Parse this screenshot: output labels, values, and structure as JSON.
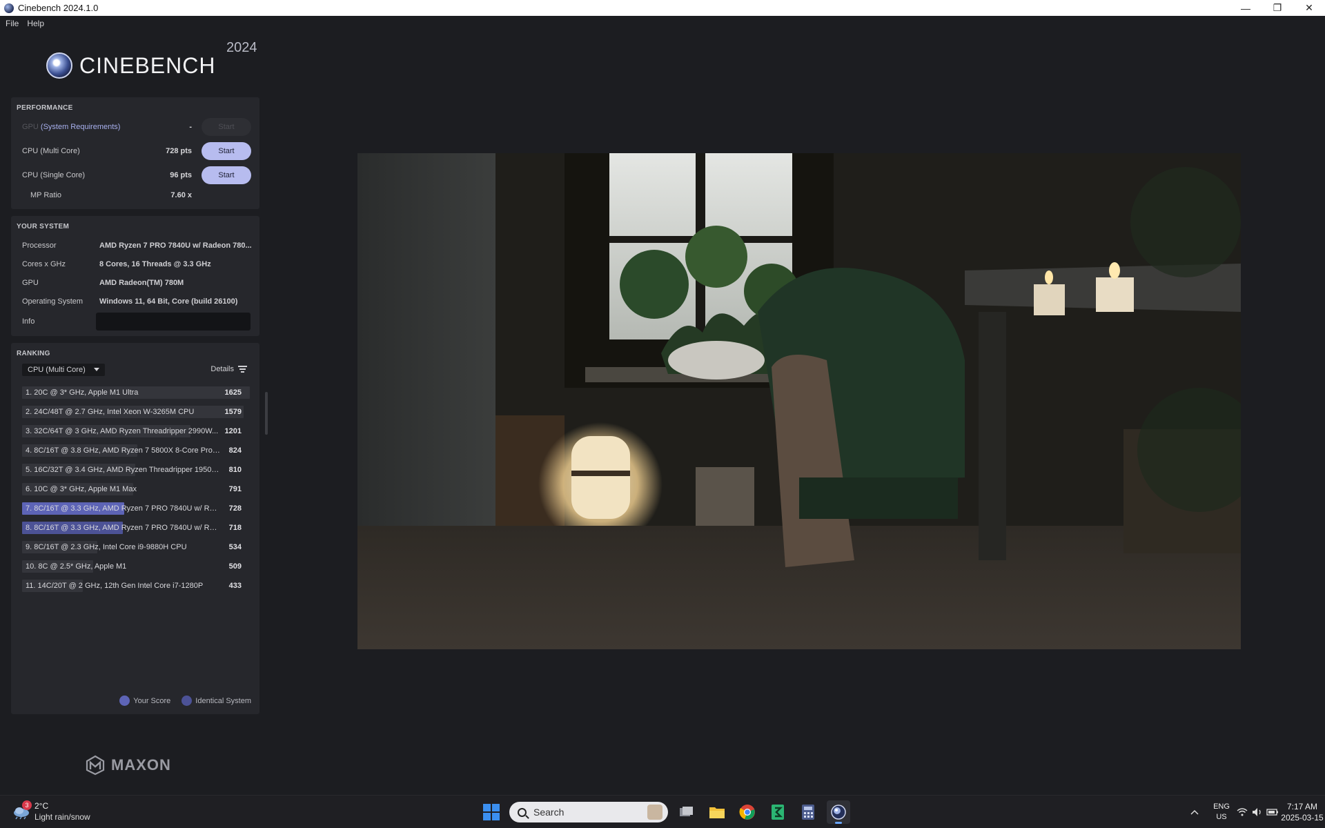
{
  "window": {
    "title": "Cinebench 2024.1.0",
    "controls": {
      "minimize": "—",
      "maximize": "❐",
      "close": "✕"
    }
  },
  "menu": {
    "file": "File",
    "help": "Help"
  },
  "logo": {
    "text": "CINEBENCH",
    "year": "2024"
  },
  "performance": {
    "title": "PERFORMANCE",
    "gpu": {
      "label": "GPU",
      "requirements": "(System Requirements)",
      "value": "-",
      "button": "Start"
    },
    "cpu_multi": {
      "label": "CPU (Multi Core)",
      "value": "728 pts",
      "button": "Start"
    },
    "cpu_single": {
      "label": "CPU (Single Core)",
      "value": "96 pts",
      "button": "Start"
    },
    "mp_ratio": {
      "label": "MP Ratio",
      "value": "7.60 x"
    }
  },
  "system": {
    "title": "YOUR SYSTEM",
    "rows": [
      {
        "key": "Processor",
        "value": "AMD Ryzen 7 PRO 7840U w/ Radeon 780..."
      },
      {
        "key": "Cores x GHz",
        "value": "8 Cores, 16 Threads @ 3.3 GHz"
      },
      {
        "key": "GPU",
        "value": "AMD Radeon(TM) 780M"
      },
      {
        "key": "Operating System",
        "value": "Windows 11, 64 Bit, Core (build 26100)"
      }
    ],
    "info_label": "Info"
  },
  "ranking": {
    "title": "RANKING",
    "dropdown": "CPU (Multi Core)",
    "details": "Details",
    "items": [
      {
        "label": "1. 20C @ 3* GHz, Apple M1 Ultra",
        "score": "1625",
        "fraction": 1.0,
        "kind": "other"
      },
      {
        "label": "2. 24C/48T @ 2.7 GHz, Intel Xeon W-3265M CPU",
        "score": "1579",
        "fraction": 0.972,
        "kind": "other"
      },
      {
        "label": "3. 32C/64T @ 3 GHz, AMD Ryzen Threadripper 2990W...",
        "score": "1201",
        "fraction": 0.739,
        "kind": "other"
      },
      {
        "label": "4. 8C/16T @ 3.8 GHz, AMD Ryzen 7 5800X 8-Core Proce...",
        "score": "824",
        "fraction": 0.507,
        "kind": "other"
      },
      {
        "label": "5. 16C/32T @ 3.4 GHz, AMD Ryzen Threadripper 1950X ...",
        "score": "810",
        "fraction": 0.498,
        "kind": "other"
      },
      {
        "label": "6. 10C @ 3* GHz, Apple M1 Max",
        "score": "791",
        "fraction": 0.487,
        "kind": "other"
      },
      {
        "label": "7. 8C/16T @ 3.3 GHz, AMD Ryzen 7 PRO 7840U w/ Rade...",
        "score": "728",
        "fraction": 0.448,
        "kind": "you"
      },
      {
        "label": "8. 8C/16T @ 3.3 GHz, AMD Ryzen 7 PRO 7840U w/ Rade...",
        "score": "718",
        "fraction": 0.442,
        "kind": "ident"
      },
      {
        "label": "9. 8C/16T @ 2.3 GHz, Intel Core i9-9880H CPU",
        "score": "534",
        "fraction": 0.329,
        "kind": "other"
      },
      {
        "label": "10. 8C @ 2.5* GHz, Apple M1",
        "score": "509",
        "fraction": 0.313,
        "kind": "other"
      },
      {
        "label": "11. 14C/20T @ 2 GHz, 12th Gen Intel Core i7-1280P",
        "score": "433",
        "fraction": 0.266,
        "kind": "other"
      }
    ],
    "legend": {
      "your_score": "Your Score",
      "identical": "Identical System"
    },
    "colors": {
      "your_score": "#5d64b6",
      "identical": "#4c5296",
      "other": "#34353b"
    }
  },
  "maxon": {
    "text": "MAXON"
  },
  "taskbar": {
    "weather": {
      "badge": "3",
      "temp": "2°C",
      "desc": "Light rain/snow"
    },
    "search_placeholder": "Search",
    "apps": [
      "task-view-icon",
      "file-explorer-icon",
      "chrome-icon",
      "green-app-icon",
      "calculator-icon",
      "cinebench-icon"
    ],
    "lang": {
      "top": "ENG",
      "bottom": "US"
    },
    "clock": {
      "time": "7:17 AM",
      "date": "2025-03-15"
    }
  }
}
